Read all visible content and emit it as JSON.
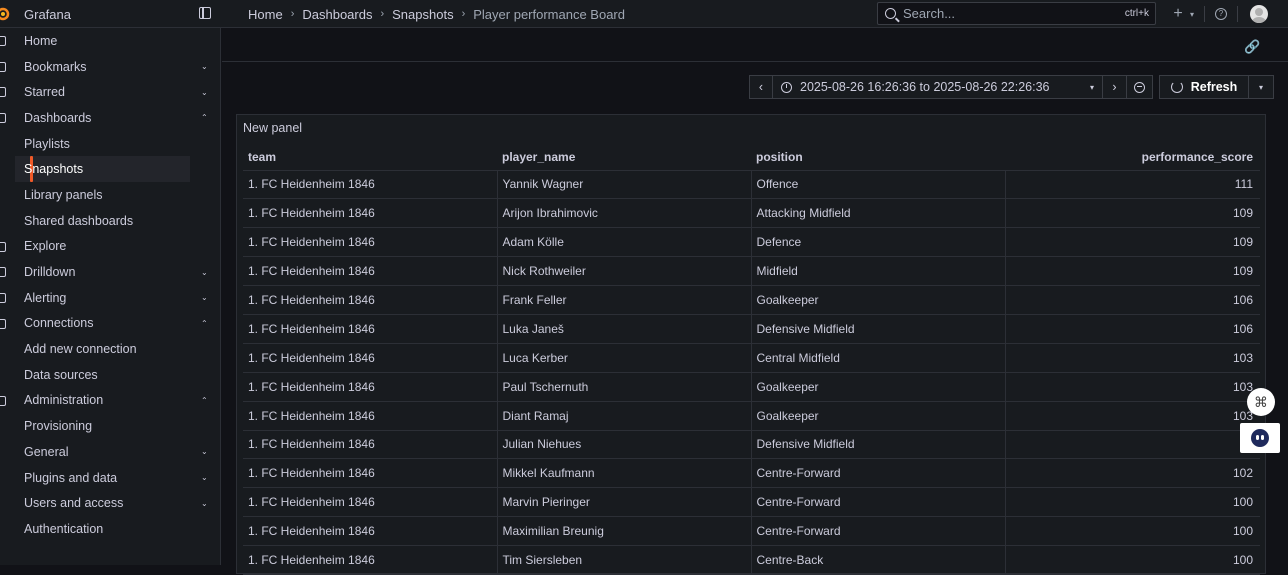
{
  "app": {
    "title": "Grafana"
  },
  "breadcrumb": [
    "Home",
    "Dashboards",
    "Snapshots",
    "Player performance Board"
  ],
  "search": {
    "placeholder": "Search...",
    "shortcut": "ctrl+k"
  },
  "topbar": {
    "new_label": "+",
    "help_label": "?"
  },
  "sidebar": {
    "items": [
      {
        "label": "Home",
        "icon": "home-icon",
        "chevron": ""
      },
      {
        "label": "Bookmarks",
        "icon": "bookmark-icon",
        "chevron": "⌄"
      },
      {
        "label": "Starred",
        "icon": "star-icon",
        "chevron": "⌄"
      },
      {
        "label": "Dashboards",
        "icon": "dashboards-icon",
        "chevron": "⌃"
      },
      {
        "label": "Playlists",
        "icon": "",
        "chevron": ""
      },
      {
        "label": "Snapshots",
        "icon": "",
        "chevron": ""
      },
      {
        "label": "Library panels",
        "icon": "",
        "chevron": ""
      },
      {
        "label": "Shared dashboards",
        "icon": "",
        "chevron": ""
      },
      {
        "label": "Explore",
        "icon": "explore-icon",
        "chevron": ""
      },
      {
        "label": "Drilldown",
        "icon": "drilldown-icon",
        "chevron": "⌄"
      },
      {
        "label": "Alerting",
        "icon": "bell-icon",
        "chevron": "⌄"
      },
      {
        "label": "Connections",
        "icon": "connections-icon",
        "chevron": "⌃"
      },
      {
        "label": "Add new connection",
        "icon": "",
        "chevron": ""
      },
      {
        "label": "Data sources",
        "icon": "",
        "chevron": ""
      },
      {
        "label": "Administration",
        "icon": "gear-icon",
        "chevron": "⌃"
      },
      {
        "label": "Provisioning",
        "icon": "",
        "chevron": ""
      },
      {
        "label": "General",
        "icon": "",
        "chevron": "⌄"
      },
      {
        "label": "Plugins and data",
        "icon": "",
        "chevron": "⌄"
      },
      {
        "label": "Users and access",
        "icon": "",
        "chevron": "⌄"
      },
      {
        "label": "Authentication",
        "icon": "",
        "chevron": ""
      }
    ],
    "active": "Snapshots"
  },
  "timepicker": {
    "range": "2025-08-26 16:26:36 to 2025-08-26 22:26:36",
    "refresh_label": "Refresh"
  },
  "panel": {
    "title": "New panel",
    "columns": [
      "team",
      "player_name",
      "position",
      "performance_score"
    ],
    "rows": [
      [
        "1. FC Heidenheim 1846",
        "Yannik Wagner",
        "Offence",
        "111"
      ],
      [
        "1. FC Heidenheim 1846",
        "Arijon Ibrahimovic",
        "Attacking Midfield",
        "109"
      ],
      [
        "1. FC Heidenheim 1846",
        "Adam Kölle",
        "Defence",
        "109"
      ],
      [
        "1. FC Heidenheim 1846",
        "Nick Rothweiler",
        "Midfield",
        "109"
      ],
      [
        "1. FC Heidenheim 1846",
        "Frank Feller",
        "Goalkeeper",
        "106"
      ],
      [
        "1. FC Heidenheim 1846",
        "Luka Janeš",
        "Defensive Midfield",
        "106"
      ],
      [
        "1. FC Heidenheim 1846",
        "Luca Kerber",
        "Central Midfield",
        "103"
      ],
      [
        "1. FC Heidenheim 1846",
        "Paul Tschernuth",
        "Goalkeeper",
        "103"
      ],
      [
        "1. FC Heidenheim 1846",
        "Diant Ramaj",
        "Goalkeeper",
        "103"
      ],
      [
        "1. FC Heidenheim 1846",
        "Julian Niehues",
        "Defensive Midfield",
        "1"
      ],
      [
        "1. FC Heidenheim 1846",
        "Mikkel Kaufmann",
        "Centre-Forward",
        "102"
      ],
      [
        "1. FC Heidenheim 1846",
        "Marvin Pieringer",
        "Centre-Forward",
        "100"
      ],
      [
        "1. FC Heidenheim 1846",
        "Maximilian Breunig",
        "Centre-Forward",
        "100"
      ],
      [
        "1. FC Heidenheim 1846",
        "Tim Siersleben",
        "Centre-Back",
        "100"
      ]
    ]
  },
  "colors": {
    "accent": "#f05a28",
    "background": "#111217",
    "surface": "#181b1f"
  }
}
